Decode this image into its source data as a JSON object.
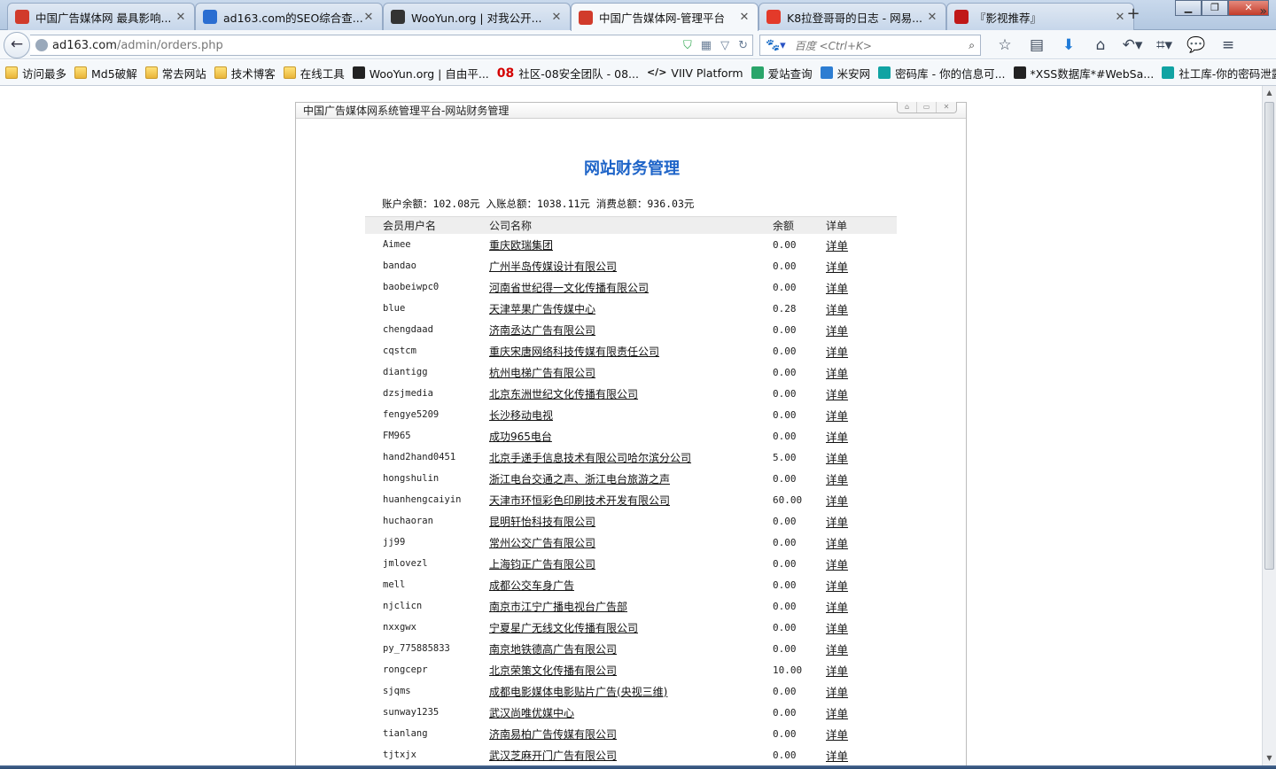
{
  "browser": {
    "tabs": [
      {
        "title": "中国广告媒体网 最具影响...",
        "active": false,
        "favicon": "#d13b2b"
      },
      {
        "title": "ad163.com的SEO综合查...",
        "active": false,
        "favicon": "#2b6ed1"
      },
      {
        "title": "WooYun.org | 对我公开...",
        "active": false,
        "favicon": "#333333"
      },
      {
        "title": "中国广告媒体网-管理平台",
        "active": true,
        "favicon": "#d13b2b"
      },
      {
        "title": "K8拉登哥哥的日志 - 网易...",
        "active": false,
        "favicon": "#e33a2a"
      },
      {
        "title": "『影视推荐』",
        "active": false,
        "favicon": "#c01818"
      }
    ],
    "url_host": "ad163.com",
    "url_path": "/admin/orders.php",
    "search_engine": "百度",
    "search_placeholder": "百度 <Ctrl+K>",
    "bookmarks": [
      {
        "label": "访问最多",
        "icon": "folder"
      },
      {
        "label": "Md5破解",
        "icon": "folder"
      },
      {
        "label": "常去网站",
        "icon": "folder"
      },
      {
        "label": "技术博客",
        "icon": "folder"
      },
      {
        "label": "在线工具",
        "icon": "folder"
      },
      {
        "label": "WooYun.org | 自由平...",
        "icon": "dark"
      },
      {
        "label": "社区-08安全团队 - 08...",
        "icon": "red",
        "glyph": "08"
      },
      {
        "label": "VIIV Platform",
        "icon": "code",
        "glyph": "</>"
      },
      {
        "label": "爱站查询",
        "icon": "green"
      },
      {
        "label": "米安网",
        "icon": "blue"
      },
      {
        "label": "密码库 - 你的信息可...",
        "icon": "teal"
      },
      {
        "label": "*XSS数据库*#WebSa...",
        "icon": "dark"
      },
      {
        "label": "社工库-你的密码泄露...",
        "icon": "teal"
      }
    ]
  },
  "panel": {
    "header": "中国广告媒体网系统管理平台-网站财务管理",
    "title": "网站财务管理",
    "summary": "账户余额：102.08元 入账总额：1038.11元 消费总额：936.03元",
    "columns": [
      "会员用户名",
      "公司名称",
      "余额",
      "详单"
    ],
    "detail_label": "详单",
    "rows": [
      {
        "user": "Aimee",
        "company": "重庆欧瑞集团",
        "balance": "0.00"
      },
      {
        "user": "bandao",
        "company": "广州半岛传媒设计有限公司",
        "balance": "0.00"
      },
      {
        "user": "baobeiwpc0",
        "company": "河南省世纪得一文化传播有限公司",
        "balance": "0.00"
      },
      {
        "user": "blue",
        "company": "天津苹果广告传媒中心",
        "balance": "0.28"
      },
      {
        "user": "chengdaad",
        "company": "济南丞达广告有限公司",
        "balance": "0.00"
      },
      {
        "user": "cqstcm",
        "company": "重庆宋唐网络科技传媒有限责任公司",
        "balance": "0.00"
      },
      {
        "user": "diantigg",
        "company": "杭州电梯广告有限公司",
        "balance": "0.00"
      },
      {
        "user": "dzsjmedia",
        "company": "北京东洲世纪文化传播有限公司",
        "balance": "0.00"
      },
      {
        "user": "fengye5209",
        "company": "长沙移动电视",
        "balance": "0.00"
      },
      {
        "user": "FM965",
        "company": "成功965电台",
        "balance": "0.00"
      },
      {
        "user": "hand2hand0451",
        "company": "北京手递手信息技术有限公司哈尔滨分公司",
        "balance": "5.00"
      },
      {
        "user": "hongshulin",
        "company": "浙江电台交通之声、浙江电台旅游之声",
        "balance": "0.00"
      },
      {
        "user": "huanhengcaiyin",
        "company": "天津市环恒彩色印刷技术开发有限公司",
        "balance": "60.00"
      },
      {
        "user": "huchaoran",
        "company": "昆明轩怡科技有限公司",
        "balance": "0.00"
      },
      {
        "user": "jj99",
        "company": "常州公交广告有限公司",
        "balance": "0.00"
      },
      {
        "user": "jmlovezl",
        "company": "上海钧正广告有限公司",
        "balance": "0.00"
      },
      {
        "user": "mell",
        "company": "成都公交车身广告",
        "balance": "0.00"
      },
      {
        "user": "njclicn",
        "company": "南京市江宁广播电视台广告部",
        "balance": "0.00"
      },
      {
        "user": "nxxgwx",
        "company": "宁夏星广无线文化传播有限公司",
        "balance": "0.00"
      },
      {
        "user": "py_775885833",
        "company": "南京地铁德高广告有限公司",
        "balance": "0.00"
      },
      {
        "user": "rongcepr",
        "company": "北京荣策文化传播有限公司",
        "balance": "10.00"
      },
      {
        "user": "sjqms",
        "company": "成都电影媒体电影贴片广告(央视三维)",
        "balance": "0.00"
      },
      {
        "user": "sunway1235",
        "company": "武汉尚唯优媒中心",
        "balance": "0.00"
      },
      {
        "user": "tianlang",
        "company": "济南易柏广告传媒有限公司",
        "balance": "0.00"
      },
      {
        "user": "tjtxjx",
        "company": "武汉芝麻开门广告有限公司",
        "balance": "0.00"
      }
    ]
  }
}
